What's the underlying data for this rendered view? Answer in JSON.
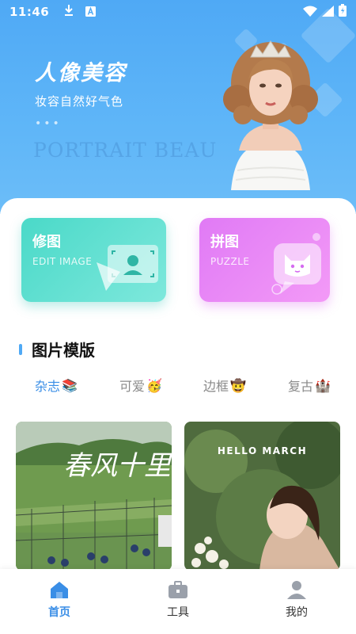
{
  "status_bar": {
    "time": "11:46",
    "icons": [
      "download-icon",
      "a-badge-icon",
      "wifi-icon",
      "signal-icon",
      "battery-icon"
    ]
  },
  "banner": {
    "title": "人像美容",
    "subtitle": "妆容自然好气色",
    "dots": "•••",
    "watermark": "PORTRAIT BEAU"
  },
  "cards": [
    {
      "title": "修图",
      "subtitle": "EDIT IMAGE",
      "icon": "portrait-frame-icon",
      "color": "#4ad9c8"
    },
    {
      "title": "拼图",
      "subtitle": "PUZZLE",
      "icon": "cat-face-icon",
      "color": "#e07af5"
    }
  ],
  "section": {
    "title": "图片模版"
  },
  "tabs": [
    {
      "label": "杂志",
      "emoji": "📚",
      "active": true
    },
    {
      "label": "可爱",
      "emoji": "🥳",
      "active": false
    },
    {
      "label": "边框",
      "emoji": "🤠",
      "active": false
    },
    {
      "label": "复古",
      "emoji": "🏰",
      "active": false
    }
  ],
  "templates": [
    {
      "text": "春风十里",
      "scene": "green-field-photo"
    },
    {
      "text": "HELLO MARCH",
      "scene": "portrait-photo"
    }
  ],
  "nav": [
    {
      "label": "首页",
      "icon": "home-icon",
      "active": true
    },
    {
      "label": "工具",
      "icon": "toolbox-icon",
      "active": false
    },
    {
      "label": "我的",
      "icon": "profile-icon",
      "active": false
    }
  ],
  "colors": {
    "accent": "#3a8ee6",
    "banner": "#4fa9f5"
  }
}
